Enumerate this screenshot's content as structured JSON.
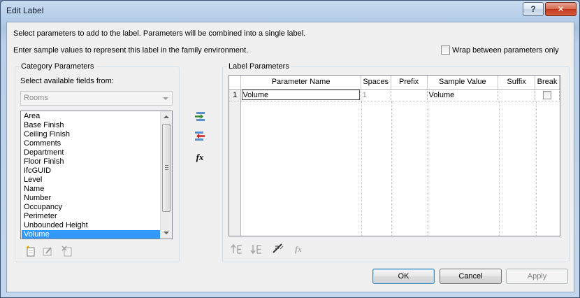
{
  "window": {
    "title": "Edit Label",
    "help_label": "?",
    "close_label": "✕"
  },
  "instructions": {
    "line1": "Select parameters to add to the label.  Parameters will be combined into a single label.",
    "line2": "Enter sample values to represent this label in the family environment."
  },
  "wrap_checkbox": {
    "label": "Wrap between parameters only",
    "checked": false
  },
  "category": {
    "group_title": "Category Parameters",
    "fields_label": "Select available fields from:",
    "category_value": "Rooms",
    "fields": [
      "Area",
      "Base Finish",
      "Ceiling Finish",
      "Comments",
      "Department",
      "Floor Finish",
      "IfcGUID",
      "Level",
      "Name",
      "Number",
      "Occupancy",
      "Perimeter",
      "Unbounded Height",
      "Volume"
    ],
    "selected_field": "Volume",
    "tool_icons": [
      "new-parameter-icon",
      "edit-parameter-icon",
      "delete-parameter-icon"
    ]
  },
  "transfer_icons": [
    "add-parameter-icon",
    "remove-parameter-icon",
    "fx-formula-icon"
  ],
  "transfer_labels": {
    "fx": "fx"
  },
  "label_params": {
    "group_title": "Label Parameters",
    "columns": [
      "Parameter Name",
      "Spaces",
      "Prefix",
      "Sample Value",
      "Suffix",
      "Break"
    ],
    "rows": [
      {
        "num": "1",
        "parameter_name": "Volume",
        "spaces": "1",
        "prefix": "",
        "sample_value": "Volume",
        "suffix": "",
        "break": false
      }
    ],
    "tool_icons": [
      "move-up-icon",
      "move-down-icon",
      "edit-unit-format-icon",
      "fx-disabled-icon"
    ],
    "fx_label": "fx"
  },
  "buttons": {
    "ok": "OK",
    "cancel": "Cancel",
    "apply": "Apply"
  }
}
